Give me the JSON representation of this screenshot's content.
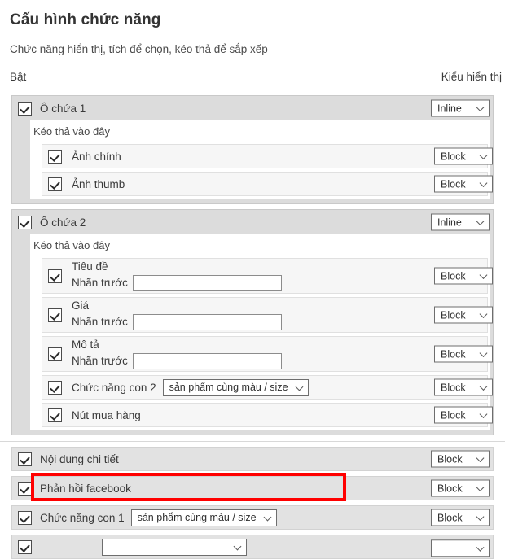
{
  "header": {
    "title": "Cấu hình chức năng",
    "subtitle": "Chức năng hiển thị, tích để chọn, kéo thả để sắp xếp",
    "col_enable": "Bật",
    "col_display_type": "Kiểu hiển thị"
  },
  "labels": {
    "drop_hint": "Kéo thả vào đây",
    "prefix_label": "Nhãn trước",
    "input_placeholder": ""
  },
  "options": {
    "inline": "Inline",
    "block": "Block",
    "same_color_size": "sản phẩm cùng màu / size"
  },
  "containers": [
    {
      "name": "container-1",
      "label": "Ô chứa 1",
      "checked": true,
      "display_type": "Inline",
      "drop_hint": "Kéo thả vào đây",
      "children": [
        {
          "name": "anh-chinh",
          "label": "Ảnh chính",
          "checked": true,
          "display_type": "Block",
          "kind": "simple"
        },
        {
          "name": "anh-thumb",
          "label": "Ảnh thumb",
          "checked": true,
          "display_type": "Block",
          "kind": "simple"
        }
      ]
    },
    {
      "name": "container-2",
      "label": "Ô chứa 2",
      "checked": true,
      "display_type": "Inline",
      "drop_hint": "Kéo thả vào đây",
      "children": [
        {
          "name": "tieu-de",
          "label": "Tiêu đề",
          "checked": true,
          "display_type": "Block",
          "kind": "prefix",
          "prefix_label": "Nhãn trước",
          "prefix_value": ""
        },
        {
          "name": "gia",
          "label": "Giá",
          "checked": true,
          "display_type": "Block",
          "kind": "prefix",
          "prefix_label": "Nhãn trước",
          "prefix_value": ""
        },
        {
          "name": "mo-ta",
          "label": "Mô tả",
          "checked": true,
          "display_type": "Block",
          "kind": "prefix",
          "prefix_label": "Nhãn trước",
          "prefix_value": ""
        },
        {
          "name": "chuc-nang-con-2",
          "label": "Chức năng con 2",
          "checked": true,
          "display_type": "Block",
          "kind": "option",
          "option_value": "sản phẩm cùng màu / size",
          "highlighted": true
        },
        {
          "name": "nut-mua-hang",
          "label": "Nút mua hàng",
          "checked": true,
          "display_type": "Block",
          "kind": "simple"
        }
      ]
    }
  ],
  "top_rows": [
    {
      "name": "noi-dung-chi-tiet",
      "label": "Nội dung chi tiết",
      "checked": true,
      "display_type": "Block",
      "kind": "simple"
    },
    {
      "name": "phan-hoi-facebook",
      "label": "Phản hồi facebook",
      "checked": true,
      "display_type": "Block",
      "kind": "simple"
    },
    {
      "name": "chuc-nang-con-1",
      "label": "Chức năng con 1",
      "checked": true,
      "display_type": "Block",
      "kind": "option",
      "option_value": "sản phẩm cùng màu / size"
    }
  ]
}
